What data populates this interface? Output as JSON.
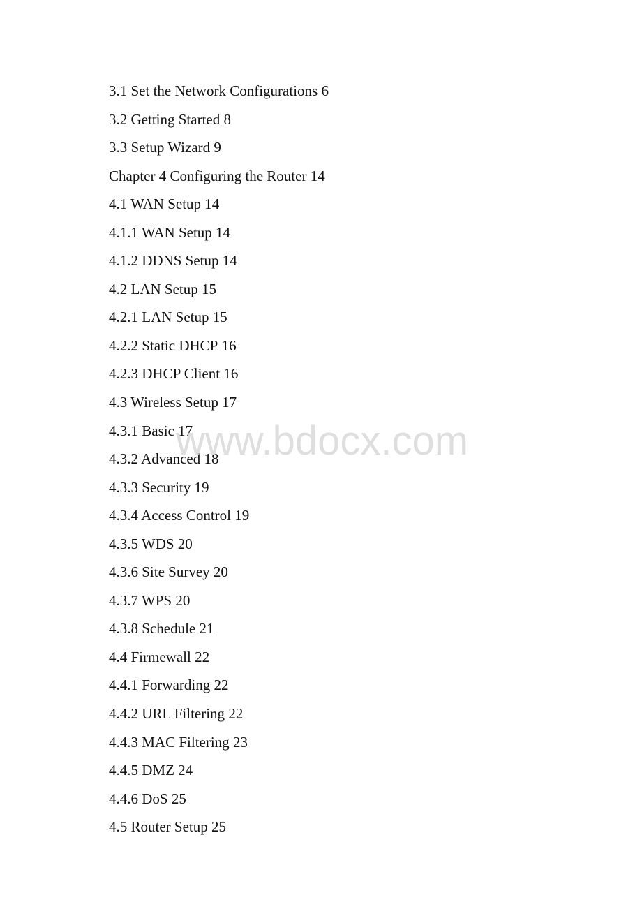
{
  "toc": [
    {
      "title": "3.1 Set the Network Configurations",
      "page": "6"
    },
    {
      "title": "3.2 Getting Started",
      "page": "8"
    },
    {
      "title": "3.3 Setup Wizard",
      "page": "9"
    },
    {
      "title": "Chapter 4 Configuring the Router",
      "page": "14"
    },
    {
      "title": "4.1 WAN Setup",
      "page": "14"
    },
    {
      "title": "4.1.1 WAN Setup",
      "page": "14"
    },
    {
      "title": "4.1.2 DDNS Setup",
      "page": "14"
    },
    {
      "title": "4.2 LAN Setup",
      "page": "15"
    },
    {
      "title": "4.2.1 LAN Setup",
      "page": "15"
    },
    {
      "title": "4.2.2 Static DHCP",
      "page": "16"
    },
    {
      "title": "4.2.3 DHCP Client",
      "page": "16"
    },
    {
      "title": "4.3 Wireless Setup",
      "page": "17"
    },
    {
      "title": "4.3.1 Basic",
      "page": "17"
    },
    {
      "title": "4.3.2 Advanced",
      "page": "18"
    },
    {
      "title": "4.3.3 Security",
      "page": "19"
    },
    {
      "title": "4.3.4 Access Control",
      "page": "19"
    },
    {
      "title": "4.3.5 WDS",
      "page": "20"
    },
    {
      "title": "4.3.6 Site Survey",
      "page": "20"
    },
    {
      "title": "4.3.7 WPS",
      "page": "20"
    },
    {
      "title": "4.3.8 Schedule",
      "page": "21"
    },
    {
      "title": "4.4 Firmewall",
      "page": "22"
    },
    {
      "title": "4.4.1 Forwarding",
      "page": "22"
    },
    {
      "title": "4.4.2 URL Filtering",
      "page": "22"
    },
    {
      "title": "4.4.3 MAC Filtering",
      "page": "23"
    },
    {
      "title": "4.4.5 DMZ",
      "page": "24"
    },
    {
      "title": "4.4.6 DoS",
      "page": "25"
    },
    {
      "title": "4.5 Router Setup",
      "page": "25"
    }
  ],
  "watermark": {
    "text": "www.bdocx.com",
    "color": "#d9d9d9"
  }
}
